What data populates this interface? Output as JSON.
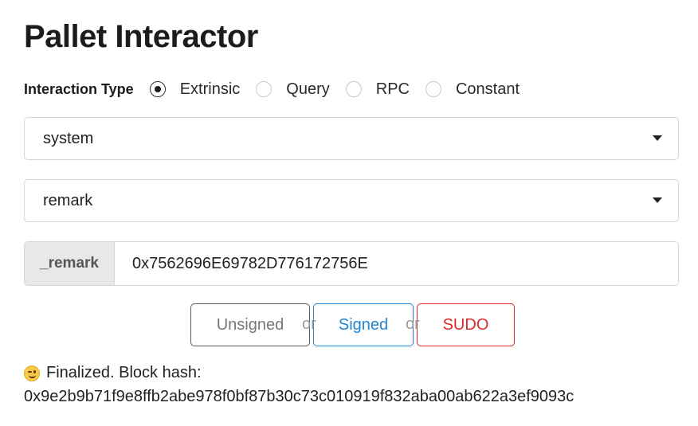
{
  "title": "Pallet Interactor",
  "interaction": {
    "label": "Interaction Type",
    "options": [
      "Extrinsic",
      "Query",
      "RPC",
      "Constant"
    ],
    "selected": "Extrinsic"
  },
  "pallet_dropdown": {
    "value": "system"
  },
  "call_dropdown": {
    "value": "remark"
  },
  "param": {
    "label": "_remark",
    "value": "0x7562696E69782D776172756E"
  },
  "buttons": {
    "unsigned": "Unsigned",
    "signed": "Signed",
    "sudo": "SUDO",
    "or": "or"
  },
  "status": {
    "icon": "wink-emoji-icon",
    "text": "Finalized. Block hash:",
    "hash": "0x9e2b9b71f9e8ffb2abe978f0bf87b30c73c010919f832aba00ab622a3ef9093c"
  },
  "colors": {
    "signed": "#2185d0",
    "sudo": "#db2828",
    "unsigned_border": "#5a5a5a"
  }
}
